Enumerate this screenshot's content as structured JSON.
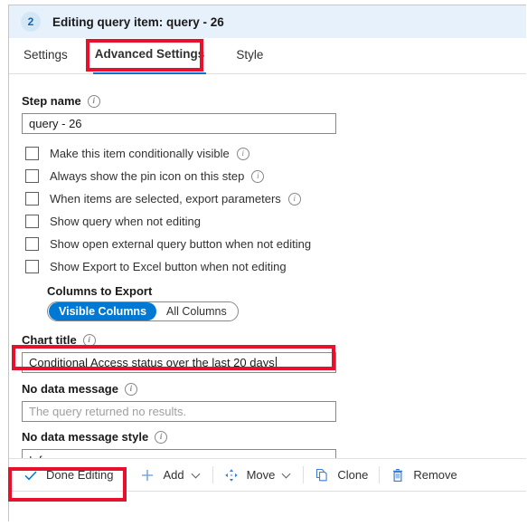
{
  "header": {
    "step_number": "2",
    "title": "Editing query item: query - 26"
  },
  "tabs": [
    {
      "label": "Settings",
      "active": false
    },
    {
      "label": "Advanced Settings",
      "active": true
    },
    {
      "label": "Style",
      "active": false
    }
  ],
  "form": {
    "step_name": {
      "label": "Step name",
      "value": "query - 26"
    },
    "checkboxes": [
      {
        "label": "Make this item conditionally visible",
        "checked": false,
        "info": true
      },
      {
        "label": "Always show the pin icon on this step",
        "checked": false,
        "info": true
      },
      {
        "label": "When items are selected, export parameters",
        "checked": false,
        "info": true
      },
      {
        "label": "Show query when not editing",
        "checked": false,
        "info": false
      },
      {
        "label": "Show open external query button when not editing",
        "checked": false,
        "info": false
      },
      {
        "label": "Show Export to Excel button when not editing",
        "checked": false,
        "info": false
      }
    ],
    "columns_to_export": {
      "label": "Columns to Export",
      "options": [
        "Visible Columns",
        "All Columns"
      ],
      "selected": "Visible Columns"
    },
    "chart_title": {
      "label": "Chart title",
      "value": "Conditional Access status over the last 20 days"
    },
    "no_data_message": {
      "label": "No data message",
      "value": "",
      "placeholder": "The query returned no results."
    },
    "no_data_message_style": {
      "label": "No data message style",
      "value": "Info"
    }
  },
  "toolbar": {
    "done_editing": "Done Editing",
    "add": "Add",
    "move": "Move",
    "clone": "Clone",
    "remove": "Remove"
  },
  "colors": {
    "accent": "#0078d4",
    "header_bg": "#e6f1fb",
    "annotation_red": "#e8112d",
    "badge_text": "#1763ad"
  }
}
